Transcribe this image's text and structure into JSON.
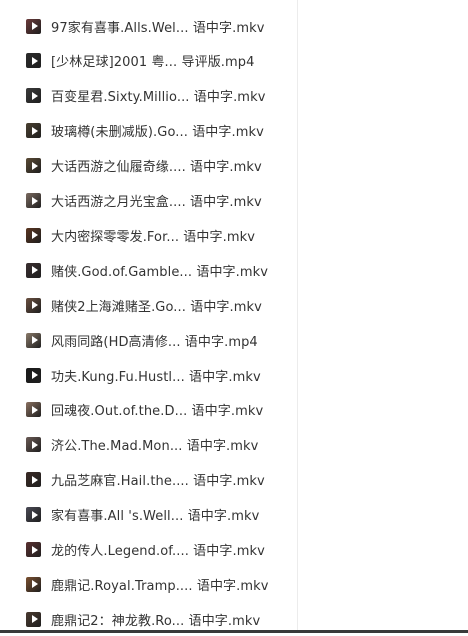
{
  "files": [
    {
      "name": "97家有喜事.Alls.Wel... 语中字.mkv",
      "icon": "video-thumbnail-icon",
      "thumb_color": "#6b3a3a"
    },
    {
      "name": "[少林足球]2001 粤...  导评版.mp4",
      "icon": "video-thumbnail-icon",
      "thumb_color": "#2b2b2b"
    },
    {
      "name": "百变星君.Sixty.Millio... 语中字.mkv",
      "icon": "video-thumbnail-icon",
      "thumb_color": "#3a3a3a"
    },
    {
      "name": "玻璃樽(未删减版).Go... 语中字.mkv",
      "icon": "video-thumbnail-icon",
      "thumb_color": "#4a4030"
    },
    {
      "name": "大话西游之仙履奇缘.... 语中字.mkv",
      "icon": "video-thumbnail-icon",
      "thumb_color": "#5a4a35"
    },
    {
      "name": "大话西游之月光宝盒.... 语中字.mkv",
      "icon": "video-thumbnail-icon",
      "thumb_color": "#7a6a60"
    },
    {
      "name": "大内密探零零发.For... 语中字.mkv",
      "icon": "video-thumbnail-icon",
      "thumb_color": "#5a3520"
    },
    {
      "name": "赌侠.God.of.Gamble... 语中字.mkv",
      "icon": "video-thumbnail-icon",
      "thumb_color": "#3a2f30"
    },
    {
      "name": "赌侠2上海滩赌圣.Go... 语中字.mkv",
      "icon": "video-thumbnail-icon",
      "thumb_color": "#6a5040"
    },
    {
      "name": "风雨同路(HD高清修... 语中字.mp4",
      "icon": "video-thumbnail-icon",
      "thumb_color": "#8a7a6a"
    },
    {
      "name": "功夫.Kung.Fu.Hustl... 语中字.mkv",
      "icon": "video-thumbnail-icon",
      "thumb_color": "#1a1a1a"
    },
    {
      "name": "回魂夜.Out.of.the.D... 语中字.mkv",
      "icon": "video-thumbnail-icon",
      "thumb_color": "#8a7060"
    },
    {
      "name": "济公.The.Mad.Mon... 语中字.mkv",
      "icon": "video-thumbnail-icon",
      "thumb_color": "#6a5a55"
    },
    {
      "name": "九品芝麻官.Hail.the.... 语中字.mkv",
      "icon": "video-thumbnail-icon",
      "thumb_color": "#3a2a25"
    },
    {
      "name": "家有喜事.All  's.Well... 语中字.mkv",
      "icon": "video-thumbnail-icon",
      "thumb_color": "#4a4a55"
    },
    {
      "name": "龙的传人.Legend.of.... 语中字.mkv",
      "icon": "video-thumbnail-icon",
      "thumb_color": "#5a3030"
    },
    {
      "name": "鹿鼎记.Royal.Tramp.... 语中字.mkv",
      "icon": "video-thumbnail-icon",
      "thumb_color": "#7a5030"
    },
    {
      "name": "鹿鼎记2：神龙教.Ro... 语中字.mkv",
      "icon": "video-thumbnail-icon",
      "thumb_color": "#4a3a30"
    }
  ]
}
